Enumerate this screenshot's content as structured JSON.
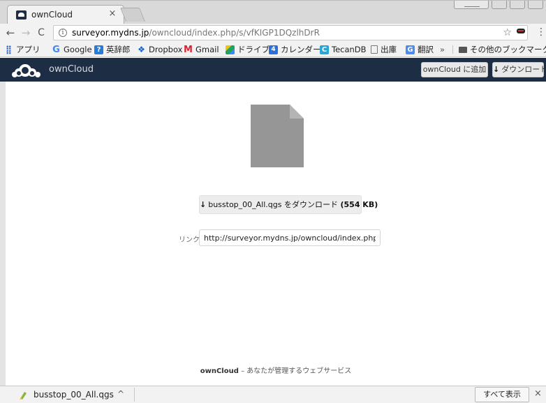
{
  "browser": {
    "tab_title": "ownCloud",
    "tab_close": "×",
    "url_host": "surveyor.mydns.jp",
    "url_path": "/owncloud/index.php/s/vfKIGP1DQzlhDrR",
    "info_glyph": "i",
    "star_glyph": "☆",
    "menu_glyph": "⋮",
    "back_glyph": "←",
    "forward_glyph": "→",
    "reload_glyph": "C"
  },
  "bookmarks": {
    "apps": "アプリ",
    "google": "Google",
    "eijiro": "英辞郎",
    "dropbox": "Dropbox",
    "gmail": "Gmail",
    "drive": "ドライブ",
    "calendar": "カレンダー",
    "tecandb": "TecanDB",
    "shukko": "出庫",
    "honyaku": "翻訳",
    "more": "»",
    "other": "その他のブックマーク"
  },
  "header": {
    "app_name": "ownCloud",
    "add_button": "ownCloud に追加",
    "download_button": "ダウンロード"
  },
  "main": {
    "download_prefix": "busstop_00_All.qgs をダウンロード",
    "file_size": "(554 KB)",
    "link_label": "リンク",
    "link_value": "http://surveyor.mydns.jp/owncloud/index.php/s/v"
  },
  "footer": {
    "brand": "ownCloud",
    "tagline": " – あなたが管理するウェブサービス"
  },
  "shelf": {
    "filename": "busstop_00_All.qgs",
    "chevron": "^",
    "show_all": "すべて表示",
    "close": "×"
  },
  "colors": {
    "header_bg": "#1d2d44",
    "file_icon": "#969696"
  },
  "icons": [
    "owncloud-favicon",
    "back-arrow-icon",
    "forward-arrow-icon",
    "reload-icon",
    "info-icon",
    "star-icon",
    "menu-icon",
    "folder-icon",
    "download-arrow-icon",
    "file-icon",
    "qgs-file-icon"
  ]
}
